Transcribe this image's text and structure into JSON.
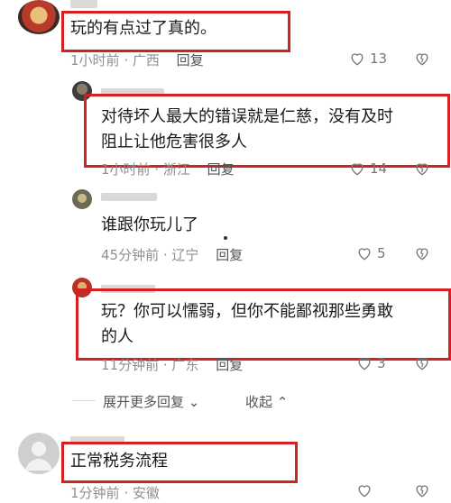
{
  "comments": [
    {
      "text": "玩的有点过了真的。",
      "time": "1小时前",
      "location": "广西",
      "reply": "回复",
      "likes": "13"
    },
    {
      "text_line1": "对待坏人最大的错误就是仁慈，没有及时",
      "text_line2": "阻止让他危害很多人",
      "time": "1小时前",
      "location": "浙江",
      "reply": "回复",
      "likes": "14"
    },
    {
      "text": "谁跟你玩儿了",
      "time": "45分钟前",
      "location": "辽宁",
      "reply": "回复",
      "likes": "5"
    },
    {
      "text_line1": "玩？你可以懦弱，但你不能鄙视那些勇敢",
      "text_line2": "的人",
      "time": "11分钟前",
      "location": "广东",
      "reply": "回复",
      "likes": "3"
    },
    {
      "text": "正常税务流程",
      "time": "1分钟前",
      "location": "安徽"
    }
  ],
  "thread_controls": {
    "expand": "展开更多回复",
    "collapse": "收起"
  },
  "colors": {
    "highlight": "#d42020",
    "meta": "#8f8f8f"
  }
}
